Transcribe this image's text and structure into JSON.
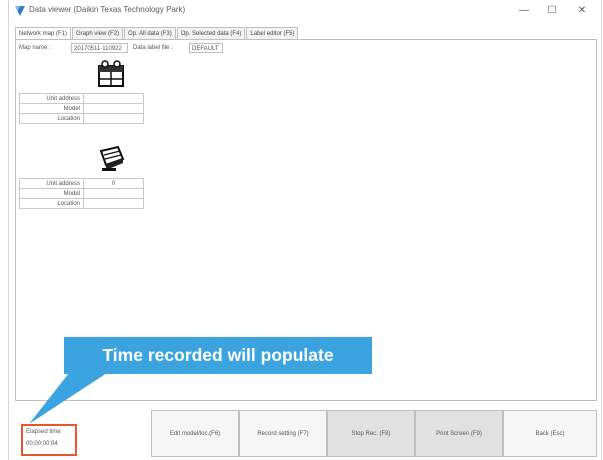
{
  "window": {
    "title": "Data viewer (Daikin Texas Technology Park)",
    "minimize_glyph": "—",
    "maximize_glyph": "☐",
    "close_glyph": "✕"
  },
  "tabs": [
    {
      "label": "Network map (F1)",
      "active": true
    },
    {
      "label": "Graph view (F2)"
    },
    {
      "label": "Op. All data (F3)"
    },
    {
      "label": "Op. Selected data (F4)"
    },
    {
      "label": "Label editor (F5)"
    }
  ],
  "header": {
    "map_name_label": "Map name :",
    "map_name_value": "20170511-110922",
    "data_label_file_label": "Data label file :",
    "data_label_file_value": "DEFAULT"
  },
  "unit_blocks": [
    {
      "icon": "outdoor-unit-icon",
      "rows": [
        {
          "label": "Unit address",
          "value": ""
        },
        {
          "label": "Model",
          "value": ""
        },
        {
          "label": "Location",
          "value": ""
        }
      ]
    },
    {
      "icon": "indoor-unit-icon",
      "rows": [
        {
          "label": "Unit address",
          "value": "0"
        },
        {
          "label": "Model",
          "value": ""
        },
        {
          "label": "Location",
          "value": ""
        }
      ]
    }
  ],
  "callout": {
    "text": "Time recorded will populate",
    "color": "#3aa3e0"
  },
  "elapsed": {
    "label": "Elapsed time",
    "value": "00:00:00:04",
    "highlight_color": "#e8542c"
  },
  "footer_buttons": [
    {
      "label": "Edit model/loc.(F6)"
    },
    {
      "label": "Record setting (F7)"
    },
    {
      "label": "Stop Rec. (F8)",
      "pressed": true
    },
    {
      "label": "Print Screen (F9)",
      "pressed": true
    },
    {
      "label": "Back (Esc)"
    }
  ]
}
